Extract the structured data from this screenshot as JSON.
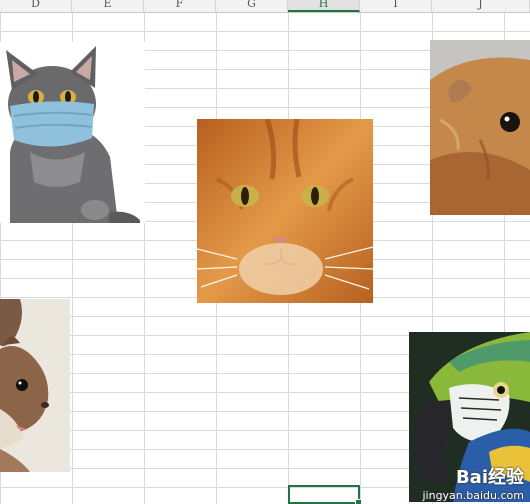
{
  "spreadsheet": {
    "column_headers": [
      "D",
      "E",
      "F",
      "G",
      "H",
      "I",
      "J"
    ],
    "active_column": "H",
    "accent_color": "#217346"
  },
  "pictures": [
    {
      "name": "kitten-with-mask",
      "subject": "gray kitten wearing a blue face mask"
    },
    {
      "name": "orange-cat",
      "subject": "orange tabby cat face"
    },
    {
      "name": "guinea-pig",
      "subject": "brown guinea pig"
    },
    {
      "name": "squirrel",
      "subject": "squirrel head"
    },
    {
      "name": "macaw-parrot",
      "subject": "blue and yellow macaw parrot"
    }
  ],
  "watermark": {
    "brand": "Bai经验",
    "url": "jingyan.baidu.com"
  }
}
